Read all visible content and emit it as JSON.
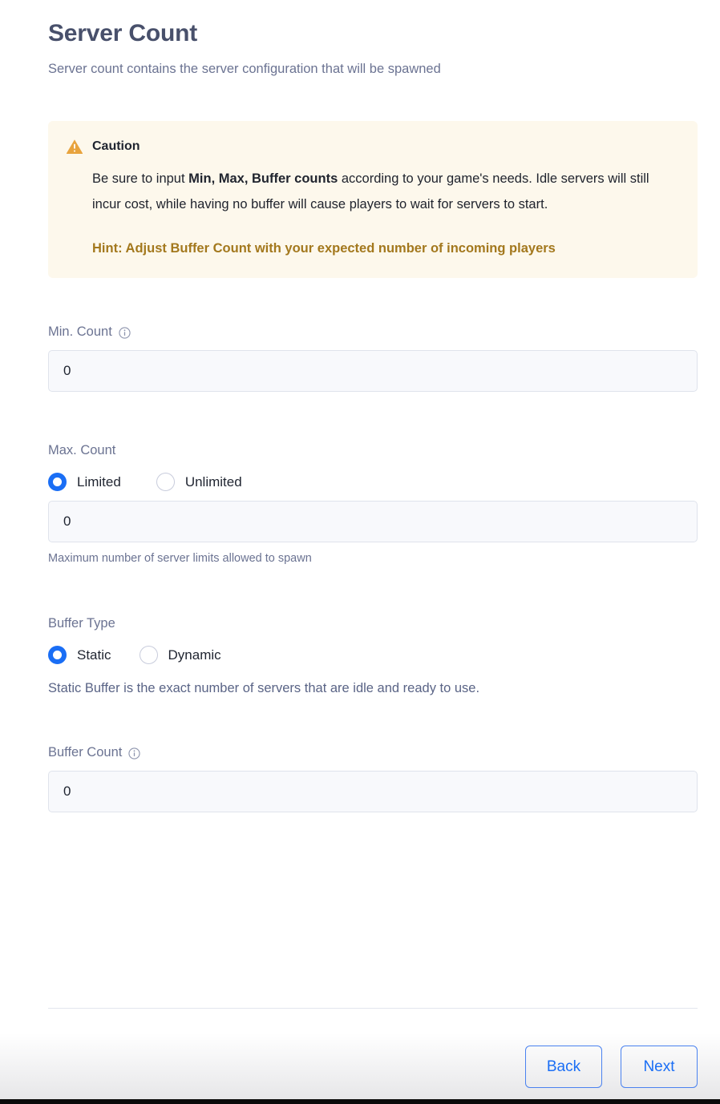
{
  "header": {
    "title": "Server Count",
    "subtitle": "Server count contains the server configuration that will be spawned"
  },
  "callout": {
    "icon": "warning-triangle-icon",
    "title": "Caution",
    "body_before": "Be sure to input ",
    "body_bold": "Min, Max, Buffer counts",
    "body_after": " according to your game's needs. Idle servers will still incur cost, while having no buffer will cause players to wait for servers to start.",
    "hint": "Hint: Adjust Buffer Count with your expected number of incoming players",
    "bg_color": "#fdf8ec",
    "icon_color": "#e8a33d",
    "hint_color": "#a3781d"
  },
  "fields": {
    "min_count": {
      "label": "Min. Count",
      "info_icon": "info-circle-icon",
      "value": "0",
      "placeholder": "0"
    },
    "max_count": {
      "label": "Max. Count",
      "options": [
        {
          "label": "Limited",
          "selected": true
        },
        {
          "label": "Unlimited",
          "selected": false
        }
      ],
      "value": "0",
      "placeholder": "0",
      "help_text": "Maximum number of server limits allowed to spawn"
    },
    "buffer_type": {
      "label": "Buffer Type",
      "options": [
        {
          "label": "Static",
          "selected": true
        },
        {
          "label": "Dynamic",
          "selected": false
        }
      ],
      "description": "Static Buffer is the exact number of servers that are idle and ready to use."
    },
    "buffer_count": {
      "label": "Buffer Count",
      "info_icon": "info-circle-icon",
      "value": "0",
      "placeholder": "0"
    }
  },
  "footer": {
    "back_label": "Back",
    "next_label": "Next",
    "accent_color": "#1a6ef5"
  }
}
